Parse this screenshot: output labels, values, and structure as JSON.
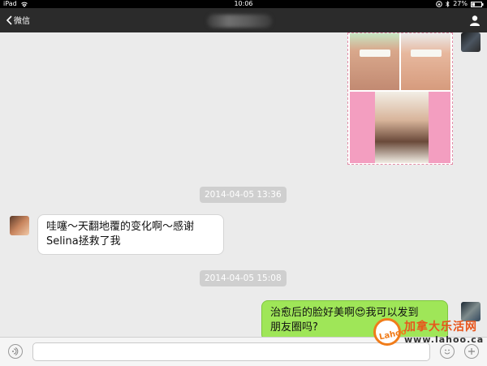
{
  "status_bar": {
    "device": "iPad",
    "time": "10:06",
    "battery": "27%"
  },
  "nav": {
    "back_label": "微信"
  },
  "messages": [
    {
      "kind": "image",
      "from": "me"
    },
    {
      "kind": "timestamp",
      "text": "2014-04-05 13:36"
    },
    {
      "kind": "text",
      "from": "Selina",
      "lines": [
        "哇噻～天翻地覆的变化啊～感谢",
        "Selina拯救了我"
      ]
    },
    {
      "kind": "timestamp",
      "text": "2014-04-05 15:08"
    },
    {
      "kind": "text",
      "from": "me",
      "lines": [
        "治愈后的脸好美啊😍我可以发到",
        "朋友圈吗?"
      ]
    }
  ],
  "watermark": {
    "logo": "Lahoo",
    "title": "加拿大乐活网",
    "url": "www.lahoo.ca"
  },
  "colors": {
    "nav_bg": "#2b2b2b",
    "chat_bg": "#ebebeb",
    "outgoing_bubble": "#9fe658",
    "incoming_bubble": "#ffffff",
    "watermark_accent": "#f07c1a"
  }
}
